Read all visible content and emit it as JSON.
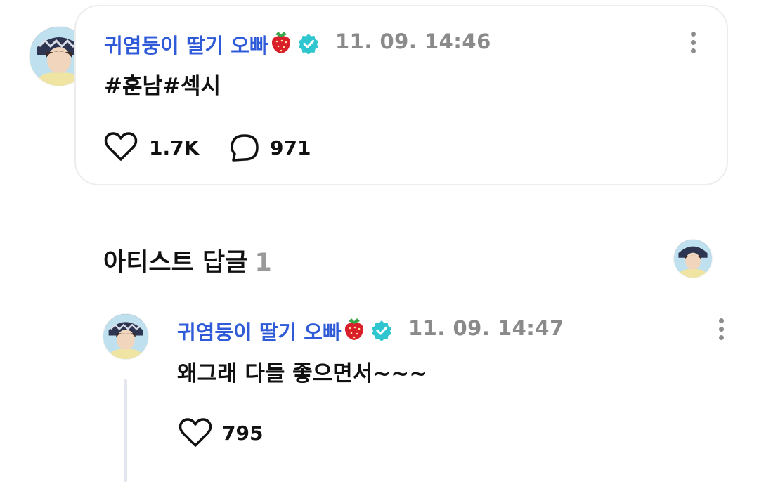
{
  "post": {
    "author_name": "귀염둥이 딸기 오빠",
    "timestamp": "11. 09. 14:46",
    "text": "#훈남#섹시",
    "likes": "1.7K",
    "comments": "971"
  },
  "replies_section": {
    "title": "아티스트 답글",
    "count": "1"
  },
  "reply": {
    "author_name": "귀염둥이 딸기 오빠",
    "timestamp": "11. 09. 14:47",
    "text": "왜그래 다들 좋으면서~~~",
    "likes": "795"
  },
  "colors": {
    "author_name": "#2f5bd8",
    "verified_badge": "#2fc6cf",
    "timestamp": "#8a8a8a",
    "strawberry": "#d81f2a"
  },
  "icons": [
    "avatar",
    "strawberry-icon",
    "verified-badge-icon",
    "more-options-icon",
    "heart-icon",
    "comment-icon"
  ]
}
